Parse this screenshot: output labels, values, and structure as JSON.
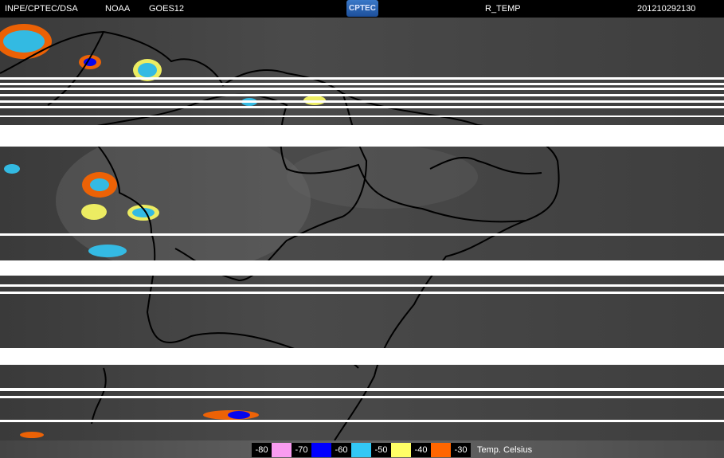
{
  "header": {
    "source": "INPE/CPTEC/DSA",
    "agency": "NOAA",
    "satellite": "GOES12",
    "logo": "CPTEC",
    "product": "R_TEMP",
    "timestamp": "201210292130"
  },
  "legend": {
    "title": "Temp. Celsius",
    "items": [
      {
        "label": "-80",
        "color": "#000000"
      },
      {
        "label": "",
        "color": "#f99cf0"
      },
      {
        "label": "-70",
        "color": "#000000"
      },
      {
        "label": "",
        "color": "#0000ff"
      },
      {
        "label": "-60",
        "color": "#000000"
      },
      {
        "label": "",
        "color": "#33c8f5"
      },
      {
        "label": "-50",
        "color": "#000000"
      },
      {
        "label": "",
        "color": "#ffff66"
      },
      {
        "label": "-40",
        "color": "#000000"
      },
      {
        "label": "",
        "color": "#ff6600"
      },
      {
        "label": "-30",
        "color": "#000000"
      }
    ]
  }
}
